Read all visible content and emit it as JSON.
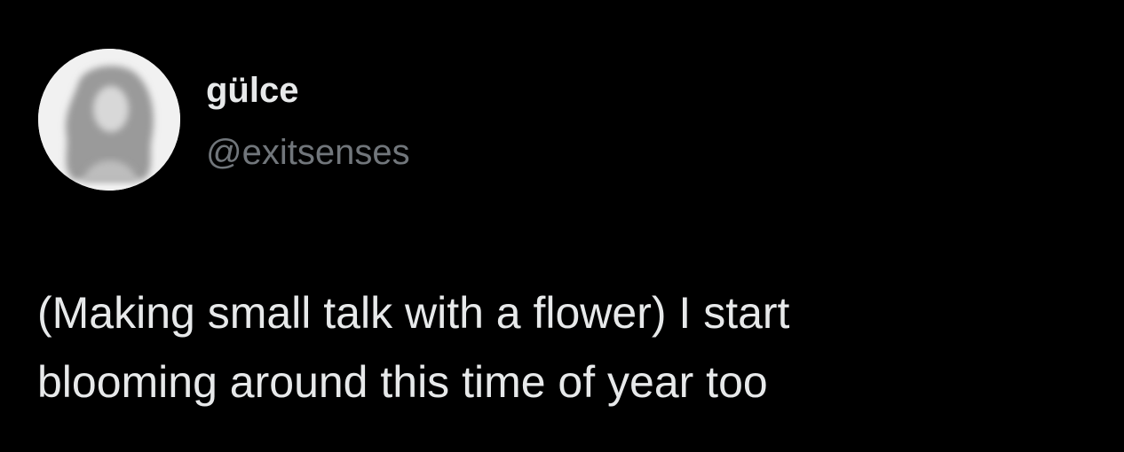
{
  "tweet": {
    "author": {
      "display_name": "gülce",
      "handle": "@exitsenses",
      "avatar_icon": "profile-photo-icon"
    },
    "text": "(Making small talk with a flower) I start\nblooming around this time of year too"
  },
  "colors": {
    "background": "#000000",
    "primary_text": "#e7e9ea",
    "secondary_text": "#71767b"
  }
}
